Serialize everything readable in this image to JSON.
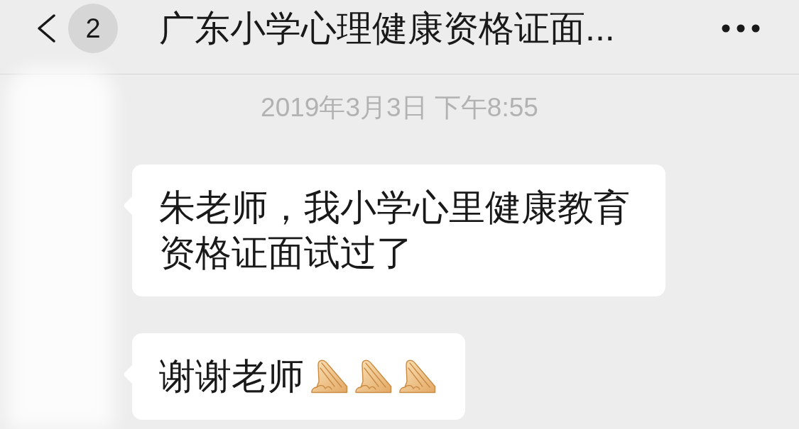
{
  "header": {
    "unread_count": "2",
    "title": "广东小学心理健康资格证面..."
  },
  "timestamp": "2019年3月3日 下午8:55",
  "messages": [
    {
      "text": "朱老师，我小学心里健康教育资格证面试过了"
    },
    {
      "text": "谢谢老师",
      "emoji": [
        {
          "kind": "palms"
        },
        {
          "kind": "palms"
        },
        {
          "kind": "palms"
        }
      ]
    }
  ]
}
